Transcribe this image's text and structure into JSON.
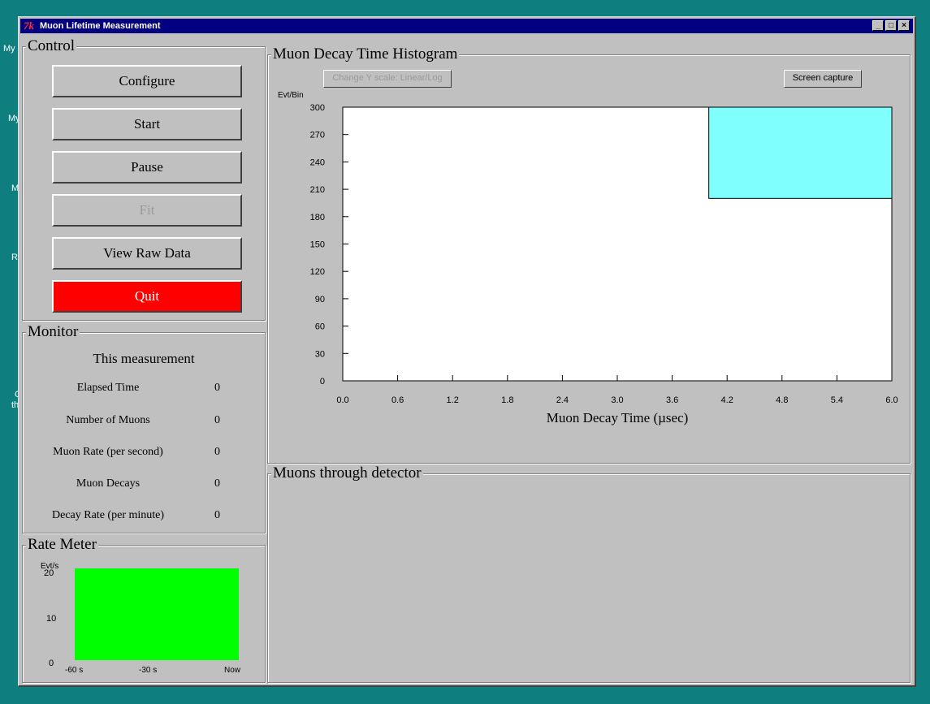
{
  "desktop": {
    "labels": [
      "My",
      "My",
      "M",
      "R",
      "C",
      "th"
    ]
  },
  "window": {
    "title": "Muon Lifetime Measurement",
    "app_icon": "tk-feather-icon"
  },
  "control": {
    "title": "Control",
    "buttons": {
      "configure": "Configure",
      "start": "Start",
      "pause": "Pause",
      "fit": "Fit",
      "view_raw": "View Raw Data",
      "quit": "Quit"
    }
  },
  "monitor": {
    "title": "Monitor",
    "heading": "This measurement",
    "rows": [
      {
        "label": "Elapsed Time",
        "value": "0"
      },
      {
        "label": "Number of Muons",
        "value": "0"
      },
      {
        "label": "Muon Rate (per second)",
        "value": "0"
      },
      {
        "label": "Muon Decays",
        "value": "0"
      },
      {
        "label": "Decay Rate (per minute)",
        "value": "0"
      }
    ]
  },
  "rate_meter": {
    "title": "Rate Meter",
    "y_unit": "Evt/s",
    "y_ticks": [
      "20",
      "10",
      "0"
    ],
    "x_ticks": [
      "-60 s",
      "-30 s",
      "Now"
    ],
    "fill_color": "#00ff00"
  },
  "histogram": {
    "title": "Muon Decay Time Histogram",
    "scale_button": "Change Y scale: Linear/Log",
    "capture_button": "Screen capture",
    "y_unit": "Evt/Bin",
    "y_ticks": [
      "300",
      "270",
      "240",
      "210",
      "180",
      "150",
      "120",
      "90",
      "60",
      "30",
      "0"
    ],
    "x_ticks": [
      "0.0",
      "0.6",
      "1.2",
      "1.8",
      "2.4",
      "3.0",
      "3.6",
      "4.2",
      "4.8",
      "5.4",
      "6.0"
    ],
    "x_label": "Muon Decay Time (µsec)",
    "bar_color": "#80ffff"
  },
  "chart_data": {
    "type": "bar",
    "title": "Muon Decay Time Histogram",
    "xlabel": "Muon Decay Time (µsec)",
    "ylabel": "Evt/Bin",
    "xlim": [
      0.0,
      6.0
    ],
    "ylim": [
      0,
      300
    ],
    "bars": [
      {
        "x0": 4.0,
        "x1": 6.0,
        "y0": 200,
        "y1": 300
      }
    ]
  },
  "detector": {
    "title": "Muons through detector"
  }
}
